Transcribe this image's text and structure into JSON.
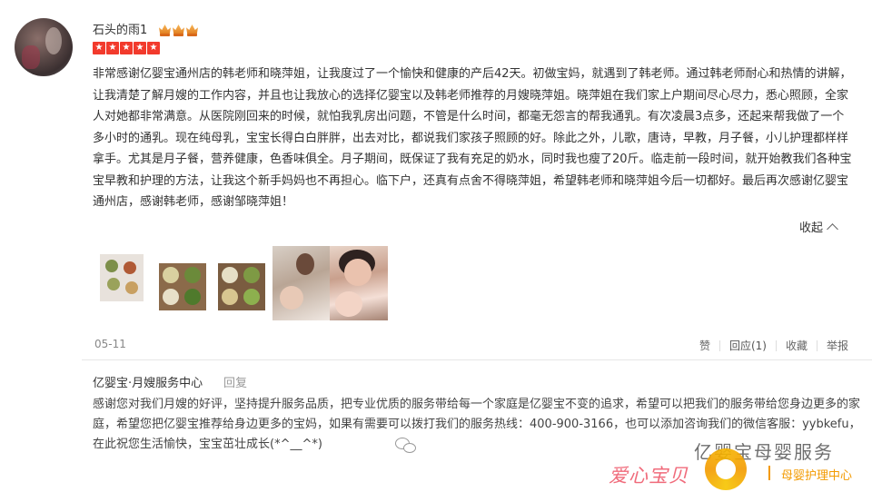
{
  "review": {
    "username": "石头的雨1",
    "crowns": [
      "crown-icon",
      "crown-icon",
      "crown-icon"
    ],
    "rating_stars": 5,
    "star_glyph": "★",
    "text": "非常感谢亿婴宝通州店的韩老师和晓萍姐，让我度过了一个愉快和健康的产后42天。初做宝妈，就遇到了韩老师。通过韩老师耐心和热情的讲解，让我清楚了解月嫂的工作内容，并且也让我放心的选择亿婴宝以及韩老师推荐的月嫂晓萍姐。晓萍姐在我们家上户期间尽心尽力，悉心照顾，全家人对她都非常满意。从医院刚回来的时候，就怕我乳房出问题，不管是什么时间，都毫无怨言的帮我通乳。有次凌晨3点多，还起来帮我做了一个多小时的通乳。现在纯母乳，宝宝长得白白胖胖，出去对比，都说我们家孩子照顾的好。除此之外，儿歌，唐诗，早教，月子餐，小儿护理都样样拿手。尤其是月子餐，营养健康，色香味俱全。月子期间，既保证了我有充足的奶水，同时我也瘦了20斤。临走前一段时间，就开始教我们各种宝宝早教和护理的方法，让我这个新手妈妈也不再担心。临下户，还真有点舍不得晓萍姐，希望韩老师和晓萍姐今后一切都好。最后再次感谢亿婴宝通州店，感谢韩老师，感谢邹晓萍姐！",
    "collapse_label": "收起",
    "date": "05-11",
    "actions": {
      "like": "赞",
      "reply": "回应(1)",
      "favorite": "收藏",
      "report": "举报"
    }
  },
  "shop_reply": {
    "name": "亿婴宝·月嫂服务中心",
    "tag": "回复",
    "text": "感谢您对我们月嫂的好评，坚持提升服务品质，把专业优质的服务带给每一个家庭是亿婴宝不变的追求，希望可以把我们的服务带给您身边更多的家庭，希望您把亿婴宝推荐给身边更多的宝妈，如果有需要可以拨打我们的服务热线：400-900-3166，也可以添加咨询我们的微信客服：yybkefu，在此祝您生活愉快，宝宝茁壮成长(*^__^*)"
  },
  "watermark": {
    "top_text": "亿婴宝母婴服务",
    "love_text": "爱心宝贝",
    "care_text": "母婴护理中心"
  },
  "colors": {
    "star_red": "#f23a2c",
    "crown_orange": "#e07b1c",
    "watermark_pink": "#f06b7b",
    "watermark_orange": "#f39a00"
  }
}
